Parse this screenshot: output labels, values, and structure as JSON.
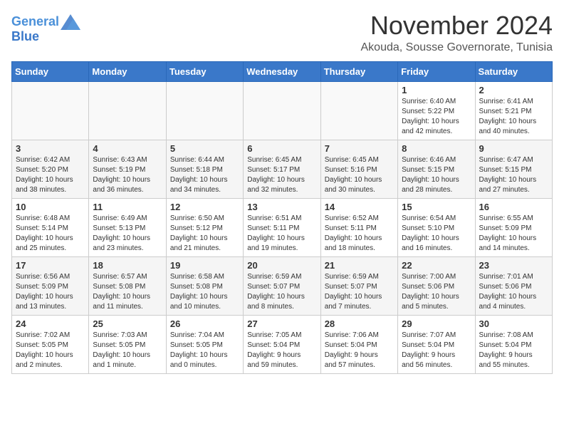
{
  "header": {
    "logo_line1": "General",
    "logo_line2": "Blue",
    "month_year": "November 2024",
    "location": "Akouda, Sousse Governorate, Tunisia"
  },
  "weekdays": [
    "Sunday",
    "Monday",
    "Tuesday",
    "Wednesday",
    "Thursday",
    "Friday",
    "Saturday"
  ],
  "weeks": [
    [
      {
        "day": "",
        "info": ""
      },
      {
        "day": "",
        "info": ""
      },
      {
        "day": "",
        "info": ""
      },
      {
        "day": "",
        "info": ""
      },
      {
        "day": "",
        "info": ""
      },
      {
        "day": "1",
        "info": "Sunrise: 6:40 AM\nSunset: 5:22 PM\nDaylight: 10 hours\nand 42 minutes."
      },
      {
        "day": "2",
        "info": "Sunrise: 6:41 AM\nSunset: 5:21 PM\nDaylight: 10 hours\nand 40 minutes."
      }
    ],
    [
      {
        "day": "3",
        "info": "Sunrise: 6:42 AM\nSunset: 5:20 PM\nDaylight: 10 hours\nand 38 minutes."
      },
      {
        "day": "4",
        "info": "Sunrise: 6:43 AM\nSunset: 5:19 PM\nDaylight: 10 hours\nand 36 minutes."
      },
      {
        "day": "5",
        "info": "Sunrise: 6:44 AM\nSunset: 5:18 PM\nDaylight: 10 hours\nand 34 minutes."
      },
      {
        "day": "6",
        "info": "Sunrise: 6:45 AM\nSunset: 5:17 PM\nDaylight: 10 hours\nand 32 minutes."
      },
      {
        "day": "7",
        "info": "Sunrise: 6:45 AM\nSunset: 5:16 PM\nDaylight: 10 hours\nand 30 minutes."
      },
      {
        "day": "8",
        "info": "Sunrise: 6:46 AM\nSunset: 5:15 PM\nDaylight: 10 hours\nand 28 minutes."
      },
      {
        "day": "9",
        "info": "Sunrise: 6:47 AM\nSunset: 5:15 PM\nDaylight: 10 hours\nand 27 minutes."
      }
    ],
    [
      {
        "day": "10",
        "info": "Sunrise: 6:48 AM\nSunset: 5:14 PM\nDaylight: 10 hours\nand 25 minutes."
      },
      {
        "day": "11",
        "info": "Sunrise: 6:49 AM\nSunset: 5:13 PM\nDaylight: 10 hours\nand 23 minutes."
      },
      {
        "day": "12",
        "info": "Sunrise: 6:50 AM\nSunset: 5:12 PM\nDaylight: 10 hours\nand 21 minutes."
      },
      {
        "day": "13",
        "info": "Sunrise: 6:51 AM\nSunset: 5:11 PM\nDaylight: 10 hours\nand 19 minutes."
      },
      {
        "day": "14",
        "info": "Sunrise: 6:52 AM\nSunset: 5:11 PM\nDaylight: 10 hours\nand 18 minutes."
      },
      {
        "day": "15",
        "info": "Sunrise: 6:54 AM\nSunset: 5:10 PM\nDaylight: 10 hours\nand 16 minutes."
      },
      {
        "day": "16",
        "info": "Sunrise: 6:55 AM\nSunset: 5:09 PM\nDaylight: 10 hours\nand 14 minutes."
      }
    ],
    [
      {
        "day": "17",
        "info": "Sunrise: 6:56 AM\nSunset: 5:09 PM\nDaylight: 10 hours\nand 13 minutes."
      },
      {
        "day": "18",
        "info": "Sunrise: 6:57 AM\nSunset: 5:08 PM\nDaylight: 10 hours\nand 11 minutes."
      },
      {
        "day": "19",
        "info": "Sunrise: 6:58 AM\nSunset: 5:08 PM\nDaylight: 10 hours\nand 10 minutes."
      },
      {
        "day": "20",
        "info": "Sunrise: 6:59 AM\nSunset: 5:07 PM\nDaylight: 10 hours\nand 8 minutes."
      },
      {
        "day": "21",
        "info": "Sunrise: 6:59 AM\nSunset: 5:07 PM\nDaylight: 10 hours\nand 7 minutes."
      },
      {
        "day": "22",
        "info": "Sunrise: 7:00 AM\nSunset: 5:06 PM\nDaylight: 10 hours\nand 5 minutes."
      },
      {
        "day": "23",
        "info": "Sunrise: 7:01 AM\nSunset: 5:06 PM\nDaylight: 10 hours\nand 4 minutes."
      }
    ],
    [
      {
        "day": "24",
        "info": "Sunrise: 7:02 AM\nSunset: 5:05 PM\nDaylight: 10 hours\nand 2 minutes."
      },
      {
        "day": "25",
        "info": "Sunrise: 7:03 AM\nSunset: 5:05 PM\nDaylight: 10 hours\nand 1 minute."
      },
      {
        "day": "26",
        "info": "Sunrise: 7:04 AM\nSunset: 5:05 PM\nDaylight: 10 hours\nand 0 minutes."
      },
      {
        "day": "27",
        "info": "Sunrise: 7:05 AM\nSunset: 5:04 PM\nDaylight: 9 hours\nand 59 minutes."
      },
      {
        "day": "28",
        "info": "Sunrise: 7:06 AM\nSunset: 5:04 PM\nDaylight: 9 hours\nand 57 minutes."
      },
      {
        "day": "29",
        "info": "Sunrise: 7:07 AM\nSunset: 5:04 PM\nDaylight: 9 hours\nand 56 minutes."
      },
      {
        "day": "30",
        "info": "Sunrise: 7:08 AM\nSunset: 5:04 PM\nDaylight: 9 hours\nand 55 minutes."
      }
    ]
  ]
}
